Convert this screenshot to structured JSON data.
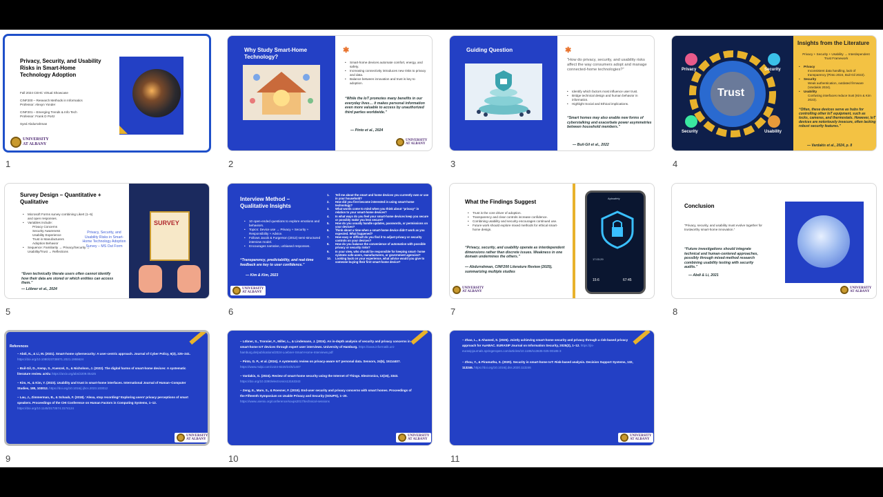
{
  "slides": [
    {
      "num": "1",
      "title": "Privacy, Security, and Usability Risks in Smart-Home Technology Adoption",
      "meta": [
        "Fall 2024 CEHC Virtual Showcase",
        "CINF200 – Research Methods in Informatics",
        "Professor: Alexyn Yonder",
        "CINF201 – Emerging Trends & Info Tech",
        "Professor: Frank D Portz",
        "Syed Abdurrahman"
      ]
    },
    {
      "num": "2",
      "title": "Why Study Smart-Home Technology?",
      "bullets": [
        "Smart-home devices automate comfort, energy, and safety.",
        "Increasing connectivity introduces new risks to privacy and data.",
        "Balance between innovation and trust is key to adoption."
      ],
      "quote": "“While the IoT promotes many benefits in our everyday lives… it makes personal information even more valuable to access by unauthorized third parties worldwide.”",
      "cite": "— Pinto et al., 2024"
    },
    {
      "num": "3",
      "title": "Guiding Question",
      "question": "“How do privacy, security, and usability risks affect the way consumers adopt and manage connected-home technologies?”",
      "bullets": [
        "Identify which factors most influence user trust.",
        "Bridge technical design and human behavior in informatics.",
        "Highlight Social and Ethical implications."
      ],
      "quote": "“Smart homes may also enable new forms of cyberstalking and exacerbate power asymmetries between household members.”",
      "cite": "— Buil-Gil et al., 2022"
    },
    {
      "num": "4",
      "title": "Insights from the Literature",
      "subtitle": "Privacy + Security + Usability → Interdependent Trust Framework",
      "gear_labels": [
        "Privacy",
        "Security",
        "Trust",
        "Security",
        "Usability"
      ],
      "items": [
        {
          "head": "Privacy",
          "text": "Inconsistent data handling, lack of transparency (Pinto 2024, Buil-Gil 2022)."
        },
        {
          "head": "Security",
          "text": "Weak authentication, outdated firmware (Vardakis 2024)."
        },
        {
          "head": "Usability",
          "text": "Confusing interfaces reduce trust (Kim & Kim 2023)."
        }
      ],
      "quote": "“Often, these devices serve as hubs for controlling other IoT equipment, such as locks, cameras, and thermostats. However, IoT devices are notoriously insecure, often lacking robust security features.”",
      "cite": "— Vardakis et al., 2024, p. 8"
    },
    {
      "num": "5",
      "title": "Survey Design – Quantitative + Qualitative",
      "bullets": [
        "Microsoft Forms survey combining Likert (1–5) and open responses.",
        "Variables include:"
      ],
      "sub": [
        "Privacy Concerns",
        "Security Awareness",
        "Usability Experience",
        "Trust in Manufacturers",
        "Adoption Behavior"
      ],
      "bullets2": [
        "Sequence: Familiarity → Privacy/Security → Usability/Trust → Reflections"
      ],
      "survey_word": "SURVEY",
      "link": "Privacy, Security, and Usability Risks in Smart-Home Technology Adoption Survey – MS Out Form",
      "quote": "“Even technically literate users often cannot identify how their data are stored or which entities can access them.”",
      "cite": "— Löbner et al., 2024"
    },
    {
      "num": "6",
      "title": "Interview Method – Qualitative Insights",
      "bullets": [
        "10 open-ended questions to explore emotions and behaviors.",
        "Topics: Device use → Privacy + Security + Responsibility + Advice.",
        "Follows Jacob & Furgerson (2012) semi-structured interview model.",
        "Encourages narrative, unbiased responses."
      ],
      "quote": "“Transparency, predictability, and real-time feedback are key to user confidence.”",
      "cite": "— Kim & Kim, 2023",
      "questions": [
        "Tell me about the smart and home devices you currently own or use in your household?",
        "How did you first become interested in using smart-home technology?",
        "What words come to mind when you think about “privacy” in relation to your smart-home devices?",
        "In what ways do you feel your smart-home devices keep you secure or possibly make you less secure?",
        "How do you usually handle updates, passwords, or permissions on your devices?",
        "Think about a time when a smart-home device didn’t work as you expected. What happened?",
        "How easy or difficult do you find it to adjust privacy or security controls on your devices?",
        "How do you balance the convenience of automation with possible privacy or security risks?",
        "In your view, who should be responsible for keeping smart- home systems safe-users, manufacturers, or government agencies?",
        "Looking back on your experience, what advice would you give to someone buying their first smart-home device?"
      ]
    },
    {
      "num": "7",
      "title": "What the Findings Suggest",
      "bullets": [
        "Trust is the core driver of adoption.",
        "Transparency and clear controls increase confidence.",
        "Combining usability and security encourages continued use.",
        "Future work should explore mixed methods for ethical smart-home design."
      ],
      "quote": "“Privacy, security, and usability operate as interdependent dimensions rather than discrete issues. Weakness in one domain undermines the others.”",
      "cite": "— Abdurrahman, CINF200 Literature Review (2025), summarizing multiple studies",
      "phone": {
        "app": "Apksafety",
        "time_left": "15:6",
        "time_right": "67:45",
        "value": "17.03.29"
      }
    },
    {
      "num": "8",
      "title": "Conclusion",
      "lead": "“Privacy, security, and usability must evolve together for trustworthy smart-home innovation.”",
      "quote": "“Future investigations should integrate technical and human-centered approaches, possibly through mixed-method research combining usability testing with security audits.”",
      "cite": "— Abdi & Li, 2021"
    },
    {
      "num": "9",
      "heading": "References",
      "refs": [
        {
          "text": "– Abdi, N., & Li, M. (2021). Smart-home cybersecurity: A user-centric approach. Journal of Cyber Policy, 6(3), 225–241.",
          "link": "https://doi.org/10.1080/23738871.2021.1955624"
        },
        {
          "text": "– Buil-Gil, D., Kemp, S., Kuenzel, S., & Nicholson, J. (2022). The digital harms of smart-home devices: A systematic literature review. arXiv.",
          "link": "https://arxiv.org/abs/2209.05425"
        },
        {
          "text": "– Kim, H., & Kim, Y. (2023). Usability and trust in smart-home interfaces. International Journal of Human–Computer Studies, 180, 103012.",
          "link": "https://doi.org/10.1016/j.ijhcs.2023.103012"
        },
        {
          "text": "– Lau, J., Zimmerman, B., & Schaub, F. (2018). ‘Alexa, stop recording!’ Exploring users’ privacy perceptions of smart speakers. Proceedings of the CHI Conference on Human Factors in Computing Systems, 1–12.",
          "link": "https://doi.org/10.1145/3173574.3174124"
        }
      ]
    },
    {
      "num": "10",
      "refs": [
        {
          "text": "– Löbner, S., Tronnier, F., Miller, L., & Lindemann, J. (2024). An in-depth analysis of security and privacy concerns in smart-home IoT devices through expert user interviews. University of Hamburg.",
          "link": "https://www.informatik.uni-hamburg.de/publications/2024-Loebner-Smart-Home-Interviews.pdf"
        },
        {
          "text": "– Pinto, G. P., et al. (2024). A systematic review on privacy-aware IoT personal data. Sensors, 24(5), 15114407.",
          "link": "https://www.mdpi.com/1424-8220/24/5/1407"
        },
        {
          "text": "– Vardakis, G. (2024). Review of smart-home security using the Internet of Things. Electronics, 13(16), 3343.",
          "link": "https://doi.org/10.3390/electronics13163343"
        },
        {
          "text": "– Zeng, E., Mare, S., & Roesner, F. (2019). End-user security and privacy concerns with smart homes. Proceedings of the Fifteenth Symposium on Usable Privacy and Security (SOUPS), 1–20.",
          "link": "https://www.usenix.org/conference/soups2017/technical-sessions"
        }
      ]
    },
    {
      "num": "11",
      "refs": [
        {
          "text": "– Zhao, L., & Ahamed, S. (2025). Jointly achieving smart-home security and privacy through a risk-based privacy approach for AaABAC. EURASIP Journal on Information Security, 2025(2), 1–12.",
          "link": "https://jis-eurasipjournals.springeropen.com/articles/10.1186/s13635-025-00185-3"
        },
        {
          "text": "– Zhou, Y., & Piramuthu, S. (2020). Security in smart-home IoT: Risk-based analysis. Decision Support Systems, 132, 113246.",
          "link": "https://doi.org/10.1016/j.dss.2020.113246"
        }
      ]
    }
  ],
  "logo_text": [
    "UNIVERSITY",
    "AT ALBANY"
  ],
  "colors": {
    "blue": "#2340c5",
    "gold": "#e8b22c",
    "selected_border": "#1e4fc9",
    "accent_star": "#e8722c"
  }
}
